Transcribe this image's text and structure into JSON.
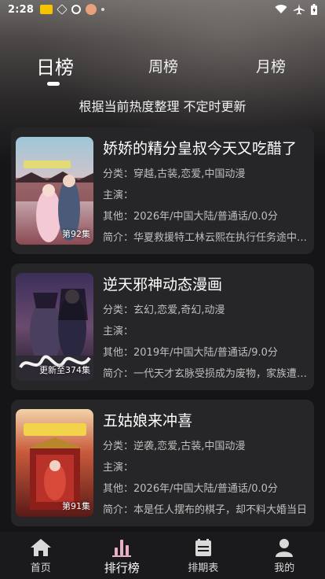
{
  "status_bar": {
    "time": "2:28"
  },
  "tabs": [
    {
      "label": "日榜",
      "active": true
    },
    {
      "label": "周榜",
      "active": false
    },
    {
      "label": "月榜",
      "active": false
    }
  ],
  "subtitle": "根据当前热度整理 不定时更新",
  "items": [
    {
      "title": "娇娇的精分皇叔今天又吃醋了",
      "category": "分类：穿越,古装,恋爱,中国动漫",
      "cast": "主演：",
      "other": "其他：2026年/中国大陆/普通话/0.0分",
      "intro": "简介：华夏救援特工林云熙在执行任务途中不幸遇难",
      "episode": "第92集"
    },
    {
      "title": "逆天邪神动态漫画",
      "category": "分类：玄幻,恋爱,奇幻,动漫",
      "cast": "主演：",
      "other": "其他：2019年/中国大陆/普通话/9.0分",
      "intro": "简介：一代天才玄脉受损成为废物，家族遭受灭门",
      "episode": "更新至374集"
    },
    {
      "title": "五姑娘来冲喜",
      "category": "分类：逆袭,恋爱,古装,中国动漫",
      "cast": "主演：",
      "other": "其他：2026年/中国大陆/普通话/0.0分",
      "intro": "简介：本是任人摆布的棋子，却不料大婚当日",
      "episode": "第91集"
    }
  ],
  "nav": [
    {
      "label": "首页",
      "icon": "home-icon"
    },
    {
      "label": "排行榜",
      "icon": "ranking-icon",
      "active": true
    },
    {
      "label": "排期表",
      "icon": "calendar-icon"
    },
    {
      "label": "我的",
      "icon": "profile-icon"
    }
  ]
}
